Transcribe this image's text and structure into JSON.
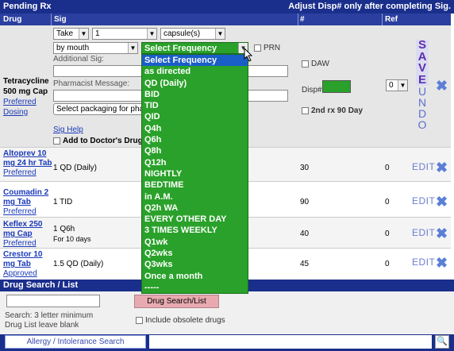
{
  "pending": {
    "title": "Pending Rx",
    "notice": "Adjust Disp# only after completing Sig.",
    "columns": {
      "drug": "Drug",
      "sig": "Sig",
      "disp": "#",
      "ref": "Ref"
    }
  },
  "editor": {
    "drug_name": "Tetracycline 500 mg Cap",
    "drug_status": "Preferred",
    "dosing_link": "Dosing",
    "action": "Take",
    "quantity": "1",
    "unit": "capsule(s)",
    "route": "by mouth",
    "frequency": "Select Frequency",
    "prn_label": "PRN",
    "additional_sig_label": "Additional Sig:",
    "pharmacist_message_label": "Pharmacist Message:",
    "packaging_placeholder": "Select packaging for pha",
    "sig_help": "Sig Help",
    "add_to_list": "Add to Doctor's Drug",
    "daw_label": "DAW",
    "disp_label": "Disp#",
    "second_rx": "2nd rx 90 Day",
    "refill_value": "0",
    "save_letters": [
      "S",
      "A",
      "V",
      "E"
    ],
    "undo_letters": [
      "U",
      "N",
      "D",
      "O"
    ]
  },
  "frequency_options": [
    "Select Frequency",
    "as directed",
    "QD (Daily)",
    "BID",
    "TID",
    "QID",
    "Q4h",
    "Q6h",
    "Q8h",
    "Q12h",
    "NIGHTLY",
    "BEDTIME",
    "in A.M.",
    "Q2h WA",
    "EVERY OTHER DAY",
    "3 TIMES WEEKLY",
    "Q1wk",
    "Q2wks",
    "Q3wks",
    "Once a month",
    "-----"
  ],
  "rx_rows": [
    {
      "drug": "Altoprev 10 mg 24 hr Tab",
      "status": "Preferred",
      "sig": "1 QD (Daily)",
      "sig_extra": "",
      "disp": "30",
      "ref": "0",
      "edit": "EDIT"
    },
    {
      "drug": "Coumadin 2 mg Tab",
      "status": "Preferred",
      "sig": "1 TID",
      "sig_extra": "",
      "disp": "90",
      "ref": "0",
      "edit": "EDIT"
    },
    {
      "drug": "Keflex 250 mg Cap",
      "status": "Preferred",
      "sig": "1 Q6h",
      "sig_extra": "For 10 days",
      "disp": "40",
      "ref": "0",
      "edit": "EDIT"
    },
    {
      "drug": "Crestor 10 mg Tab",
      "status": "Approved",
      "sig": "1.5 QD (Daily)",
      "sig_extra": "",
      "disp": "45",
      "ref": "0",
      "edit": "EDIT"
    }
  ],
  "search": {
    "title": "Drug Search / List",
    "button": "Drug Search/List",
    "hint_line1": "Search: 3 letter minimum",
    "hint_line2": "Drug List leave blank",
    "obsolete_label": "Include obsolete drugs",
    "allergy_tab": "Allergy / Intolerance Search"
  },
  "colors": {
    "header": "#1a2e8c",
    "dropdown": "#2aa12a",
    "selected": "#1a5ec8",
    "save": "#5a2fb0"
  }
}
